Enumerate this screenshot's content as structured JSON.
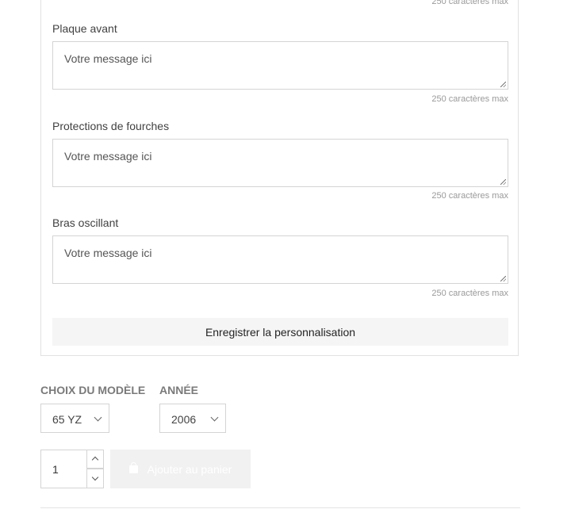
{
  "customization": {
    "max_hint": "250 caractères max",
    "fields": [
      {
        "label": "Plaque avant",
        "placeholder": "Votre message ici",
        "hint": "250 caractères max"
      },
      {
        "label": "Protections de fourches",
        "placeholder": "Votre message ici",
        "hint": "250 caractères max"
      },
      {
        "label": "Bras oscillant",
        "placeholder": "Votre message ici",
        "hint": "250 caractères max"
      }
    ],
    "save_label": "Enregistrer la personnalisation"
  },
  "variants": {
    "model_label": "CHOIX DU MODÈLE",
    "model_value": "65 YZ",
    "year_label": "ANNÉE",
    "year_value": "2006"
  },
  "cart": {
    "quantity": "1",
    "add_label": "Ajouter au panier"
  }
}
